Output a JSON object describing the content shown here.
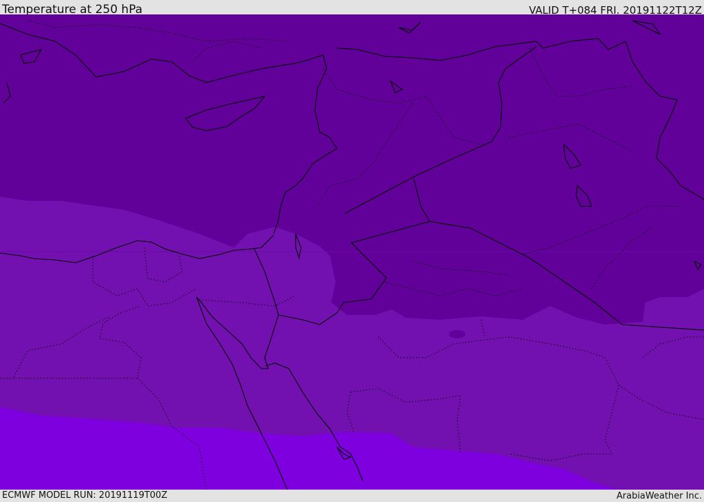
{
  "header": {
    "title": "Temperature at 250 hPa",
    "valid_time": "VALID T+084 FRI. 20191122T12Z"
  },
  "footer": {
    "model_run": "ECMWF MODEL RUN: 20191119T00Z",
    "credit": "ArabiaWeather Inc."
  },
  "colors": {
    "band_cold": "#62009a",
    "band_mid": "#7310b0",
    "band_warm": "#7e00de",
    "coastline": "#000000",
    "background": "#e3e3e3"
  }
}
